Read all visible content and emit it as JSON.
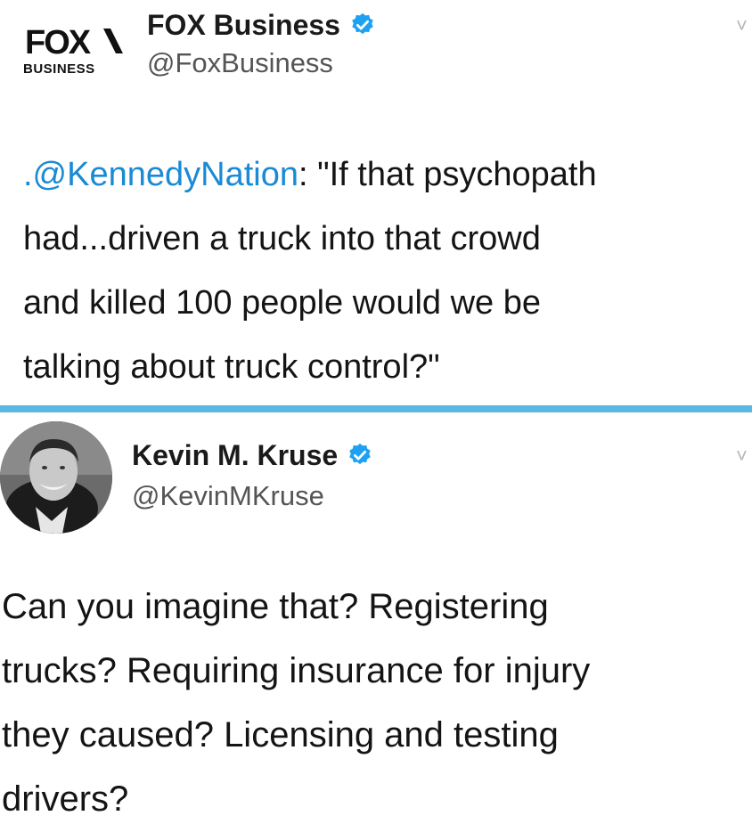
{
  "tweets": [
    {
      "account": {
        "name": "FOX Business",
        "handle": "@FoxBusiness",
        "logo_text_top": "FOX",
        "logo_text_bottom": "BUSINESS",
        "verified": true
      },
      "body": {
        "mention": ".@KennedyNation",
        "lines": [
          ": \"If that psychopath",
          "had...driven a truck into that crowd",
          "and killed 100 people would we be",
          "talking about truck control?\""
        ]
      }
    },
    {
      "account": {
        "name": "Kevin M. Kruse",
        "handle": "@KevinMKruse",
        "verified": true
      },
      "body": {
        "lines": [
          "Can you imagine that? Registering",
          "trucks? Requiring insurance for injury",
          "they caused? Licensing and testing",
          "drivers?"
        ]
      }
    }
  ],
  "colors": {
    "divider": "#5bb8e0",
    "verified_badge": "#1da1f2",
    "mention": "#1a8ad4"
  },
  "icons": [
    "fox-business-logo",
    "verified-badge-icon",
    "chevron-down-icon",
    "avatar-photo"
  ]
}
